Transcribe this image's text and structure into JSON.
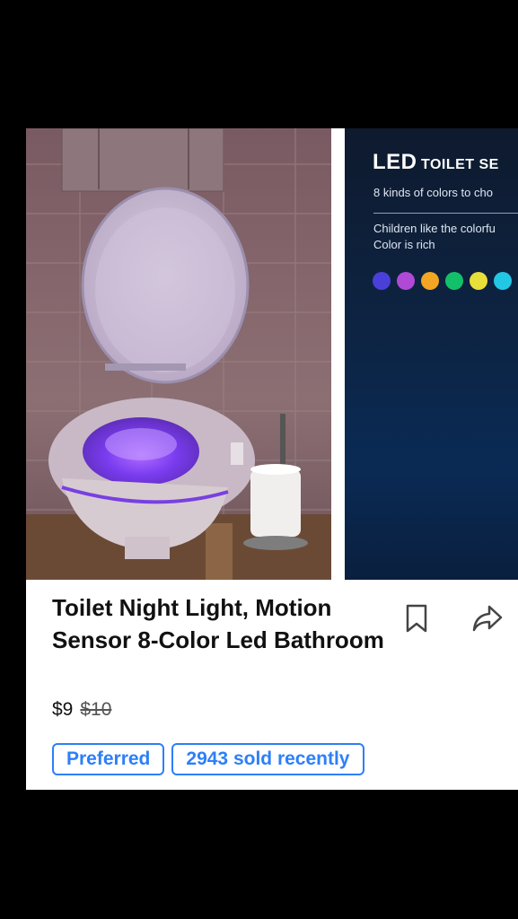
{
  "product": {
    "title": "Toilet Night Light, Motion Sensor 8-Color Led Bathroom",
    "price": "$9",
    "original_price": "$10",
    "badges": [
      "Preferred",
      "2943 sold recently"
    ]
  },
  "gallery": {
    "image2": {
      "heading_big": "LED",
      "heading_small": "TOILET SE",
      "subtitle": "8 kinds of colors to cho",
      "desc_line1": "Children like the colorfu",
      "desc_line2": "Color is rich",
      "color_dots": [
        "#4b3fd9",
        "#b04ad6",
        "#f2a623",
        "#13c06a",
        "#e9df3a",
        "#22c7e6"
      ]
    }
  },
  "icons": [
    "bookmark-icon",
    "share-icon"
  ],
  "colors": {
    "accent": "#2d7ff9",
    "background": "#000000",
    "card": "#ffffff"
  }
}
